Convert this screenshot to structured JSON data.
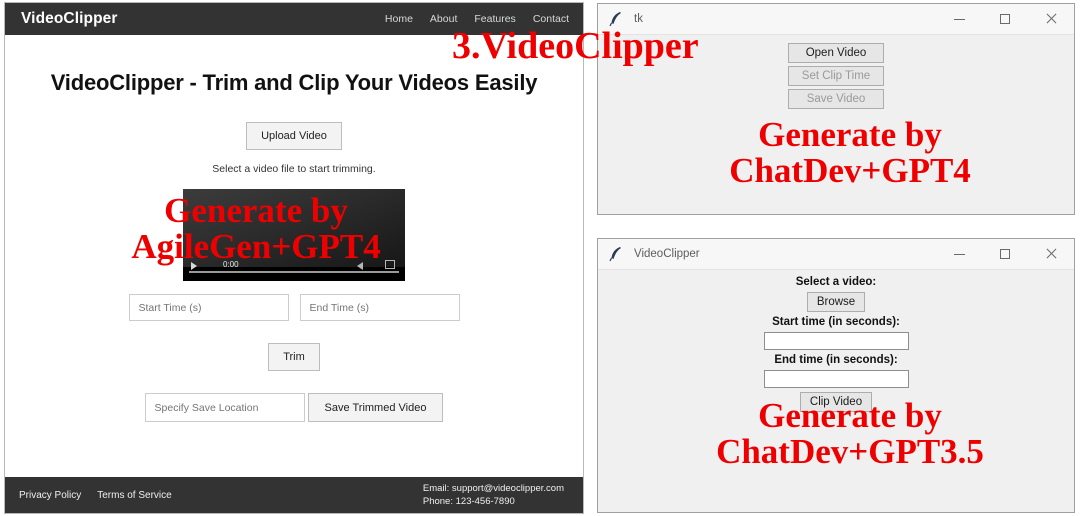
{
  "web_app": {
    "brand": "VideoClipper",
    "nav": [
      {
        "label": "Home"
      },
      {
        "label": "About"
      },
      {
        "label": "Features"
      },
      {
        "label": "Contact"
      }
    ],
    "hero_title": "VideoClipper - Trim and Clip Your Videos Easily",
    "upload_button": "Upload Video",
    "upload_hint": "Select a video file to start trimming.",
    "video_time": "0:00",
    "start_time_placeholder": "Start Time (s)",
    "end_time_placeholder": "End Time (s)",
    "trim_button": "Trim",
    "save_location_placeholder": "Specify Save Location",
    "save_trimmed_button": "Save Trimmed Video",
    "footer": {
      "privacy_link": "Privacy Policy",
      "terms_link": "Terms of Service",
      "email": "Email: support@videoclipper.com",
      "phone": "Phone: 123-456-7890"
    }
  },
  "tk_window_top": {
    "title": "tk",
    "buttons": [
      {
        "label": "Open Video",
        "state": "enabled"
      },
      {
        "label": "Set Clip Time",
        "state": "disabled"
      },
      {
        "label": "Save Video",
        "state": "disabled"
      }
    ]
  },
  "tk_window_bottom": {
    "title": "VideoClipper",
    "select_label": "Select a video:",
    "browse_button": "Browse",
    "start_label": "Start time (in seconds):",
    "start_value": "",
    "end_label": "End time (in seconds):",
    "end_value": "",
    "clip_button": "Clip Video"
  },
  "annotations": {
    "figure_title": "3.VideoClipper",
    "left_line1": "Generate by",
    "left_line2": "AgileGen+GPT4",
    "top_right_line1": "Generate by",
    "top_right_line2": "ChatDev+GPT4",
    "bottom_right_line1": "Generate by",
    "bottom_right_line2": "ChatDev+GPT3.5",
    "color": "#ee0000"
  }
}
